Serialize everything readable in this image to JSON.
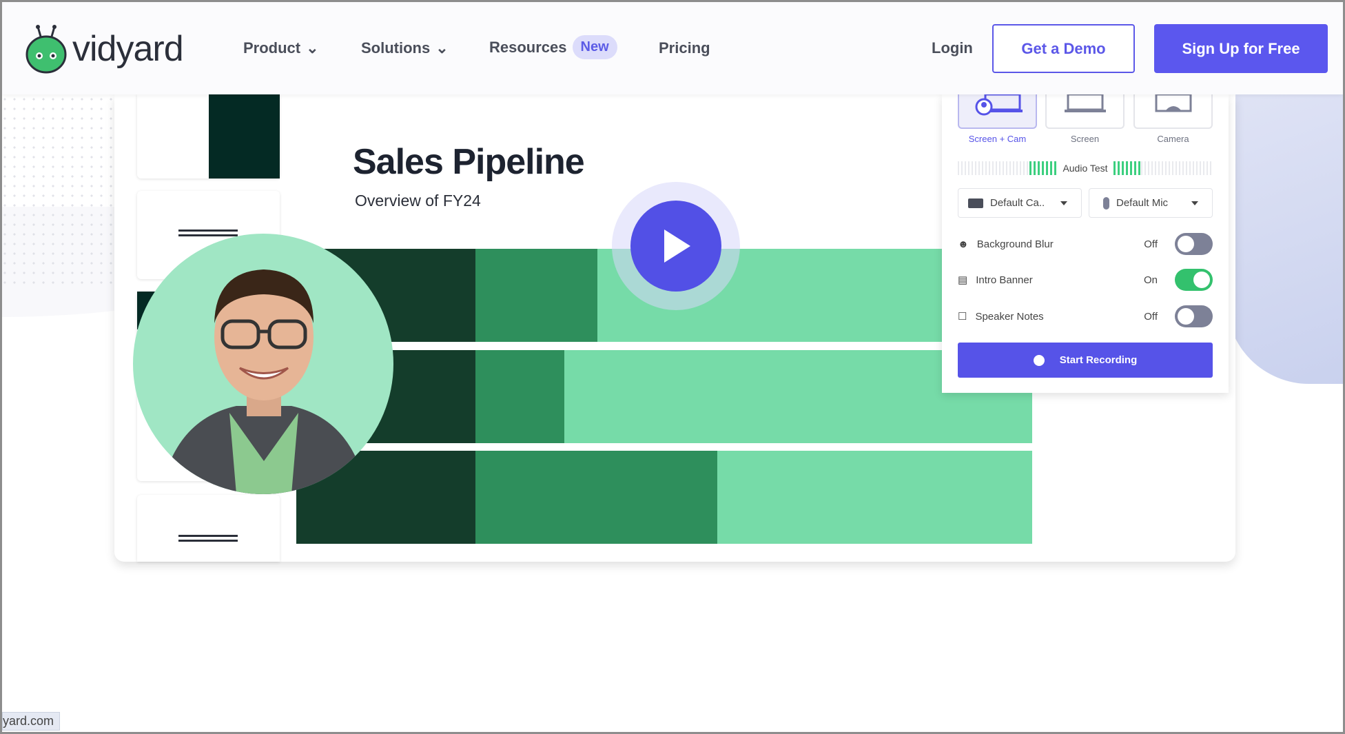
{
  "nav": {
    "logo_text": "vidyard",
    "items": [
      {
        "label": "Product",
        "has_dropdown": true
      },
      {
        "label": "Solutions",
        "has_dropdown": true
      },
      {
        "label": "Resources",
        "badge": "New"
      },
      {
        "label": "Pricing"
      }
    ],
    "login": "Login",
    "demo_button": "Get a Demo",
    "signup_button": "Sign Up for Free",
    "accent": "#5b57ee"
  },
  "slide": {
    "title": "Sales Pipeline",
    "subtitle": "Overview of FY24",
    "bar_rows": [
      [
        0.2435,
        0.1656,
        0.5909
      ],
      [
        0.2435,
        0.1208,
        0.6357
      ],
      [
        0.2435,
        0.3287,
        0.4278
      ]
    ],
    "colors": [
      "#143d2b",
      "#2e8f5c",
      "#76dba8"
    ]
  },
  "recorder": {
    "modes": [
      {
        "label": "Screen + Cam",
        "selected": true
      },
      {
        "label": "Screen",
        "selected": false
      },
      {
        "label": "Camera",
        "selected": false
      }
    ],
    "audio_test": "Audio Test",
    "camera_select": "Default Ca..",
    "mic_select": "Default Mic",
    "options": [
      {
        "label": "Background Blur",
        "state": "Off",
        "on": false
      },
      {
        "label": "Intro Banner",
        "state": "On",
        "on": true
      },
      {
        "label": "Speaker Notes",
        "state": "Off",
        "on": false
      }
    ],
    "start_button": "Start Recording"
  },
  "status_bar": {
    "url": "yard.com"
  }
}
